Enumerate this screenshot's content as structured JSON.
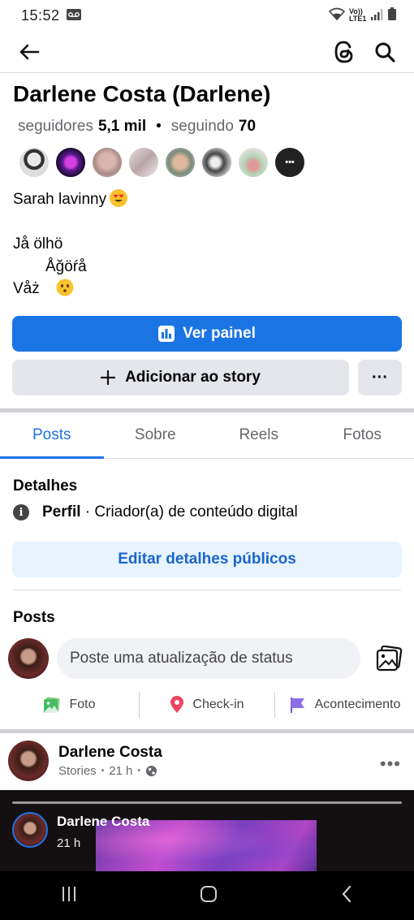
{
  "status_bar": {
    "time": "15:52",
    "network_label": "Vo)) LTE1"
  },
  "profile": {
    "name": "Darlene Costa (Darlene)",
    "followers_label": "seguidores",
    "followers_count": "5,1 mil",
    "separator": "•",
    "following_label": "seguindo",
    "following_count": "70",
    "more_friends": "•••"
  },
  "bio": {
    "line1": "Sarah lavinny",
    "line2": "Jå ölhö",
    "line3": "Åğöŕå",
    "line4": "Våż"
  },
  "buttons": {
    "dashboard": "Ver painel",
    "add_story": "Adicionar ao story",
    "more": "···",
    "edit_details": "Editar detalhes públicos"
  },
  "tabs": [
    "Posts",
    "Sobre",
    "Reels",
    "Fotos"
  ],
  "details": {
    "title": "Detalhes",
    "profile_bold": "Perfil",
    "profile_text": " · Criador(a) de conteúdo digital"
  },
  "posts": {
    "title": "Posts",
    "status_placeholder": "Poste uma atualização de status",
    "actions": {
      "photo": "Foto",
      "checkin": "Check-in",
      "event": "Acontecimento"
    }
  },
  "post": {
    "author": "Darlene Costa",
    "source": "Stories",
    "time": "21 h",
    "dot": "•",
    "more": "•••"
  },
  "story": {
    "author": "Darlene Costa",
    "time": "21 h"
  },
  "colors": {
    "primary": "#1b74e4",
    "light_button": "#e7f3ff",
    "gray_button": "#e4e6eb"
  }
}
